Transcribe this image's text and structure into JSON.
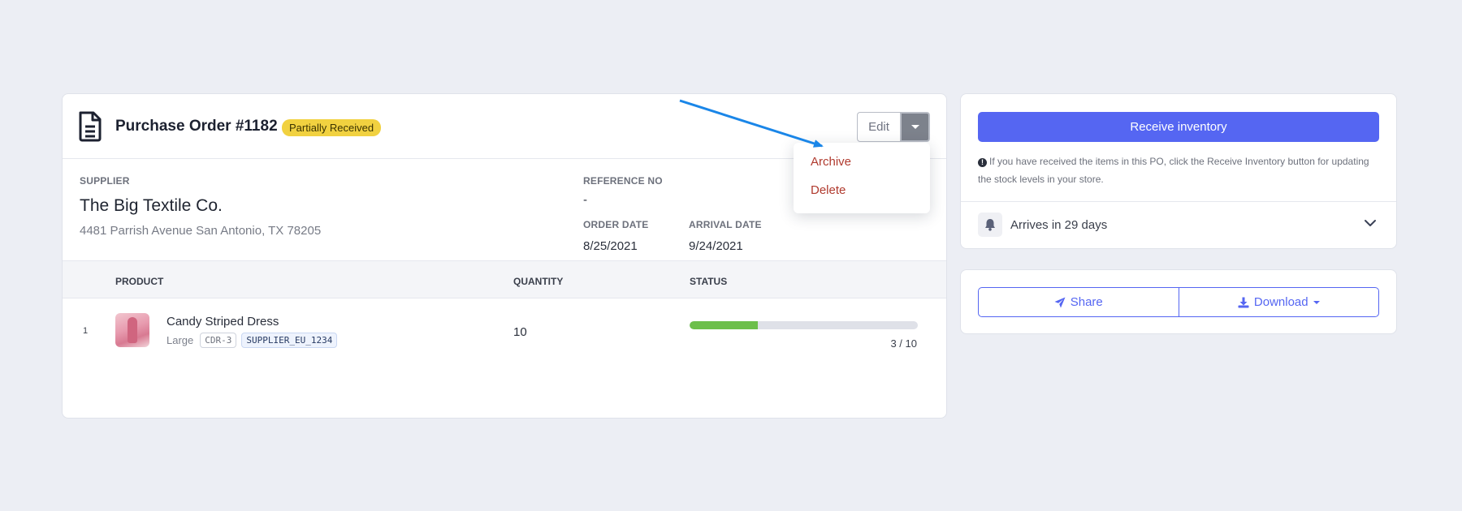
{
  "order": {
    "title": "Purchase Order #1182",
    "status_badge": "Partially Received",
    "edit_label": "Edit",
    "menu": [
      "Archive",
      "Delete"
    ]
  },
  "supplier": {
    "label": "SUPPLIER",
    "name": "The Big Textile Co.",
    "address": "4481 Parrish Avenue San Antonio, TX 78205"
  },
  "reference": {
    "label": "REFERENCE NO",
    "value": "-"
  },
  "order_date": {
    "label": "ORDER DATE",
    "value": "8/25/2021"
  },
  "arrival_date": {
    "label": "ARRIVAL DATE",
    "value": "9/24/2021"
  },
  "table": {
    "headers": {
      "product": "PRODUCT",
      "quantity": "QUANTITY",
      "status": "STATUS"
    },
    "rows": [
      {
        "index": "1",
        "product": "Candy Striped Dress",
        "variant": "Large",
        "sku": "CDR-3",
        "supplier_sku": "SUPPLIER_EU_1234",
        "quantity": "10",
        "received_fraction": 0.3,
        "progress_text": "3 / 10"
      }
    ]
  },
  "receive": {
    "button_label": "Receive inventory",
    "help_text": "If you have received the items in this PO, click the Receive Inventory button for updating the stock levels in your store.",
    "arrives_text": "Arrives in 29 days"
  },
  "actions": {
    "share_label": "Share",
    "download_label": "Download"
  },
  "colors": {
    "accent": "#5566f2",
    "badge": "#f1d140",
    "progress": "#6dbf4b",
    "danger": "#b03a2e",
    "annotation_arrow": "#1a86e8"
  }
}
